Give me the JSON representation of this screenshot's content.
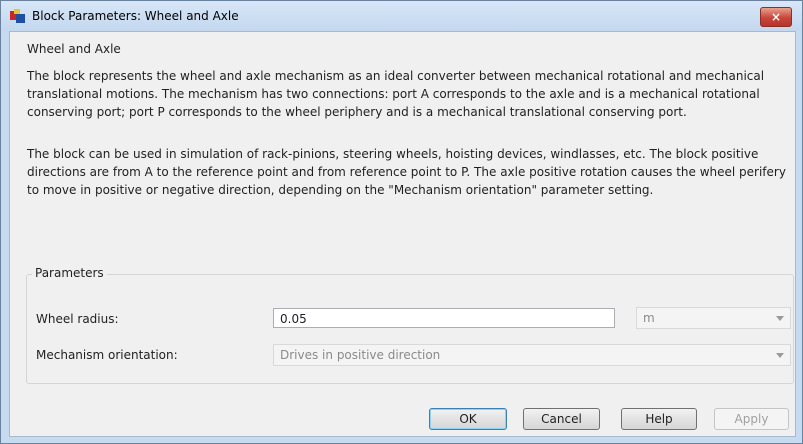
{
  "window": {
    "title": "Block Parameters: Wheel and Axle",
    "close_symbol": "×"
  },
  "block": {
    "name": "Wheel and Axle",
    "description_p1": "The block represents the wheel and axle mechanism as an ideal converter between mechanical rotational and mechanical translational motions. The mechanism has two connections: port A corresponds to the axle and is a mechanical rotational conserving port; port P corresponds to the wheel periphery and is a mechanical translational conserving port.",
    "description_p2": "The block can be used in simulation of rack-pinions, steering wheels, hoisting devices, windlasses, etc. The block positive directions are from A to the reference point and from reference point to P. The axle positive rotation causes the wheel perifery to move in positive or negative direction, depending on the \"Mechanism orientation\" parameter setting."
  },
  "parameters": {
    "label": "Parameters",
    "wheel_radius": {
      "label": "Wheel radius:",
      "value": "0.05",
      "unit": "m"
    },
    "orientation": {
      "label": "Mechanism orientation:",
      "value": "Drives in positive direction"
    }
  },
  "buttons": {
    "ok": "OK",
    "cancel": "Cancel",
    "help": "Help",
    "apply": "Apply"
  },
  "icons": {
    "app": "simulink-block-icon",
    "close": "close-icon",
    "dropdown": "chevron-down-icon"
  }
}
